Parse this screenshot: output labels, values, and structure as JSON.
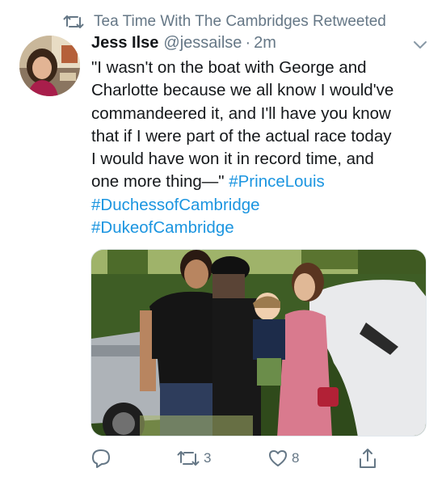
{
  "retweet_header": {
    "text": "Tea Time With The Cambridges Retweeted"
  },
  "tweet": {
    "display_name": "Jess Ilse",
    "handle": "@jessailse",
    "separator": "·",
    "time": "2m",
    "text_lines": [
      "\"I wasn't on the boat with George and",
      "Charlotte because we all know I would've",
      "commandeered it, and I'll have you know",
      "that if I were part of the actual race today",
      "I would have won it in record time, and",
      "one more thing—\""
    ],
    "hashtags": [
      "#PrinceLouis",
      "#DuchessofCambridge",
      "#DukeofCambridge"
    ]
  },
  "actions": {
    "reply_count": "",
    "retweet_count": "3",
    "like_count": "8"
  },
  "colors": {
    "link": "#1b95e0",
    "secondary": "#657786",
    "text": "#14171a"
  },
  "icons": [
    "retweet-icon",
    "chevron-down-icon",
    "reply-icon",
    "heart-icon",
    "share-icon"
  ]
}
